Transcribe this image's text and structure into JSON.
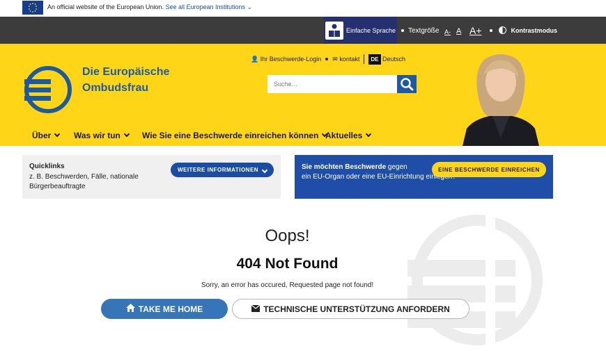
{
  "eu_bar": {
    "text": "An official website of the European Union.",
    "link": "See all European Institutions"
  },
  "utility": {
    "easy_language": "Einfache Sprache",
    "text_size": "Textgröße",
    "size_small": "A-",
    "size_normal": "A",
    "size_large": "A+",
    "contrast": "Kontrastmodus"
  },
  "brand": {
    "line1": "Die Europäische",
    "line2": "Ombudsfrau"
  },
  "header_links": {
    "login": "Ihr Beschwerde-Login",
    "contact": "kontakt",
    "lang_code": "DE",
    "lang_name": "Deutsch"
  },
  "search": {
    "placeholder": "Suche…"
  },
  "nav": {
    "items": [
      {
        "label": "Über"
      },
      {
        "label": "Was wir tun"
      },
      {
        "label": "Wie Sie eine Beschwerde einreichen können"
      },
      {
        "label": "Aktuelles"
      }
    ]
  },
  "quicklinks": {
    "title": "Quicklinks",
    "line1": "z. B. Beschwerden, Fälle, nationale",
    "line2": "Bürgerbeauftragte",
    "button": "WEITERE INFORMATIONEN"
  },
  "complaint": {
    "bold": "Sie möchten Beschwerde",
    "rest": " gegen",
    "line2": "ein EU-Organ oder eine EU-Einrichtung einlegen?",
    "button": "EINE BESCHWERDE EINREICHEN"
  },
  "error": {
    "oops": "Oops!",
    "title": "404 Not Found",
    "message": "Sorry, an error has occured, Requested page not found!",
    "home_button": "TAKE ME HOME",
    "support_button": "TECHNISCHE UNTERSTÜTZUNG ANFORDERN"
  },
  "colors": {
    "yellow": "#ffd617",
    "blue": "#1d5aa0",
    "dark": "#3c3c3c"
  }
}
